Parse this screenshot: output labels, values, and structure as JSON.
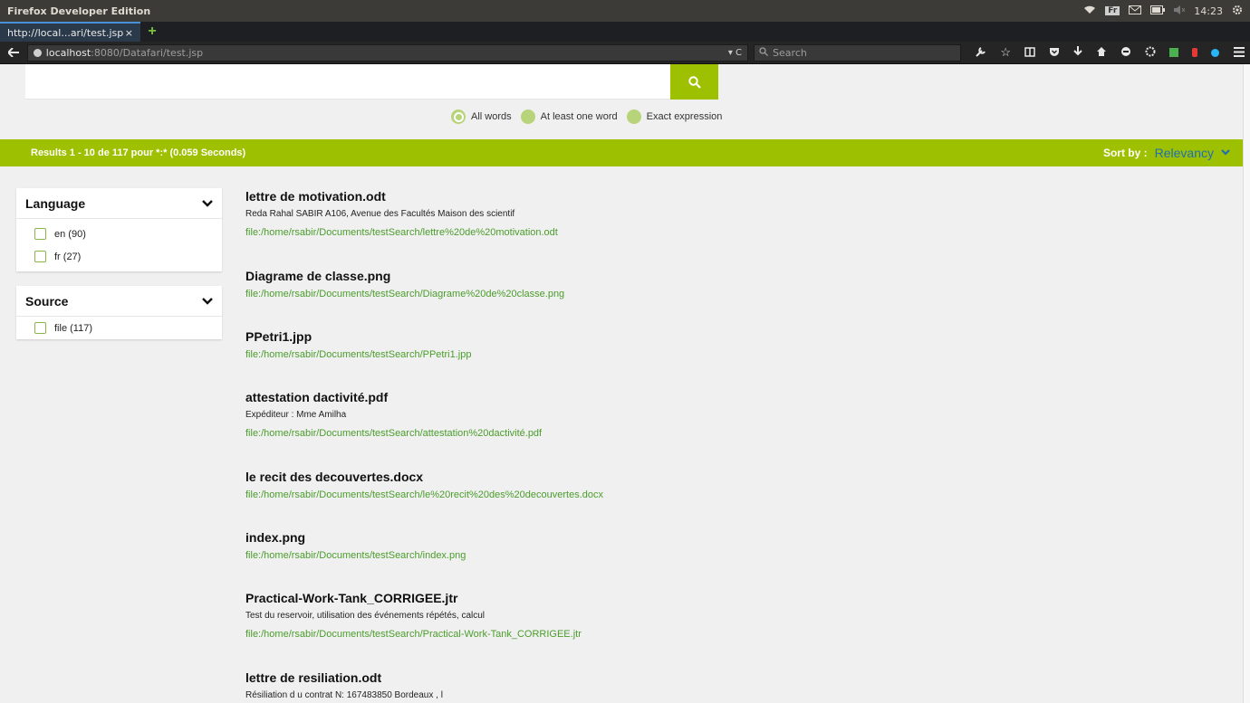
{
  "os": {
    "title": "Firefox Developer Edition",
    "tray_badge": "Fr",
    "time": "14:23"
  },
  "browser": {
    "tab_label": "http://local...ari/test.jsp",
    "tab_close": "×",
    "new_tab": "+",
    "url_host": "localhost",
    "url_rest": ":8080/Datafari/test.jsp",
    "url_actions": "▾ C",
    "search_placeholder": "Search"
  },
  "search": {
    "query": "",
    "options": [
      {
        "label": "All words",
        "checked": true
      },
      {
        "label": "At least one word",
        "checked": false
      },
      {
        "label": "Exact expression",
        "checked": false
      }
    ]
  },
  "results_bar": {
    "count_text": "Results 1 - 10 de 117 pour *:* (0.059 Seconds)",
    "sort_label": "Sort by :",
    "sort_value": "Relevancy"
  },
  "facets": [
    {
      "title": "Language",
      "items": [
        {
          "label": "en (90)"
        },
        {
          "label": "fr (27)"
        }
      ]
    },
    {
      "title": "Source",
      "items": [
        {
          "label": "file (117)"
        }
      ]
    }
  ],
  "results": [
    {
      "title": "lettre de motivation.odt",
      "snippet": "Reda Rahal SABIR A106, Avenue des Facultés Maison des scientif",
      "link": "file:/home/rsabir/Documents/testSearch/lettre%20de%20motivation.odt"
    },
    {
      "title": "Diagrame de classe.png",
      "snippet": "",
      "link": "file:/home/rsabir/Documents/testSearch/Diagrame%20de%20classe.png"
    },
    {
      "title": "PPetri1.jpp",
      "snippet": "",
      "link": "file:/home/rsabir/Documents/testSearch/PPetri1.jpp"
    },
    {
      "title": "attestation dactivité.pdf",
      "snippet": "Expéditeur : Mme Amilha",
      "link": "file:/home/rsabir/Documents/testSearch/attestation%20dactivité.pdf"
    },
    {
      "title": "le recit des decouvertes.docx",
      "snippet": "",
      "link": "file:/home/rsabir/Documents/testSearch/le%20recit%20des%20decouvertes.docx"
    },
    {
      "title": "index.png",
      "snippet": "",
      "link": "file:/home/rsabir/Documents/testSearch/index.png"
    },
    {
      "title": "Practical-Work-Tank_CORRIGEE.jtr",
      "snippet": "Test du reservoir, utilisation des événements répétés, calcul",
      "link": "file:/home/rsabir/Documents/testSearch/Practical-Work-Tank_CORRIGEE.jtr"
    },
    {
      "title": "lettre de resiliation.odt",
      "snippet": "Résiliation d u contrat N: 167483850 Bordeaux , l",
      "link": ""
    }
  ]
}
